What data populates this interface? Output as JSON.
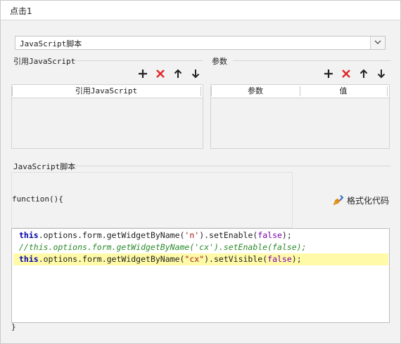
{
  "window": {
    "title": "点击1"
  },
  "script_type": {
    "selected": "JavaScript脚本"
  },
  "ref_group": {
    "label": "引用JavaScript",
    "column": "引用JavaScript"
  },
  "param_group": {
    "label": "参数",
    "columns": [
      "参数",
      "值"
    ]
  },
  "script_group": {
    "label": "JavaScript脚本"
  },
  "function_header": "function(){",
  "format_button": {
    "label": "格式化代码"
  },
  "code": {
    "line1": {
      "kw": "this",
      "body": ".options.form.getWidgetByName(",
      "str": "'n'",
      "mid": ").setEnable(",
      "bool": "false",
      "tail": ");"
    },
    "line2": {
      "comment": "//this.options.form.getWidgetByName('cx').setEnable(false);"
    },
    "line3": {
      "kw": "this",
      "body": ".options.form.getWidgetByName(",
      "str": "\"cx\"",
      "mid": ").setVisible(",
      "bool": "false",
      "tail": ");"
    }
  },
  "closing_brace": "}",
  "colors": {
    "add": "#222222",
    "delete": "#e0282c",
    "highlight": "#fffaa8",
    "keyword": "#0000a8",
    "string": "#a31515",
    "comment": "#2a8a2a"
  }
}
